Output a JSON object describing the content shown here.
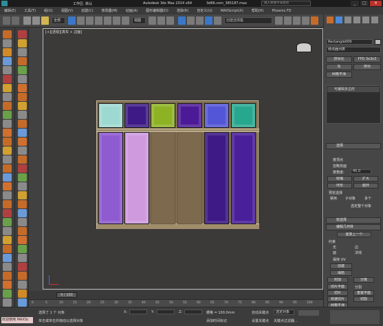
{
  "title": {
    "app": "Autodesk 3ds Max  2014 x64",
    "file": "3d66.com_385187.max",
    "search_placeholder": "键入关键字或短语",
    "workspace_label": "工作区: 默认"
  },
  "menu": [
    "编辑(E)",
    "工具(T)",
    "组(G)",
    "视图(V)",
    "创建(C)",
    "修改器(M)",
    "动画(A)",
    "图形编辑器(D)",
    "渲染(R)",
    "自定义(U)",
    "MAXScript(X)",
    "帮助(H)",
    "Phoenix FD"
  ],
  "toolbar": {
    "filter_value": "全部",
    "view_value": "视图",
    "selection_set_placeholder": "创建选择集"
  },
  "viewport": {
    "label": "[+][透视][真实 + 边面]"
  },
  "command_panel": {
    "object_name": "Rectangle009",
    "modifier_list": "修改器列表",
    "buttons": [
      "挤出化",
      "FFD 3x3x3",
      "车",
      "挤出",
      "网格平滑"
    ],
    "stack_item": "可编辑多边形",
    "selection_title": "选择",
    "selection_options": [
      "按顶点",
      "忽略背面",
      "按角度:",
      "收缩",
      "扩大",
      "环形",
      "循环"
    ],
    "angle_value": "45.0",
    "preview_label": "预览选择",
    "preview_options": [
      "禁用",
      "子对象",
      "多个"
    ],
    "selected_count": "选定整个对象",
    "soft_sel_title": "软选择",
    "edit_geom_title": "编辑几何体",
    "repeat_last": "重复上一个",
    "constraint_label": "约束",
    "constraint_options": [
      "无",
      "边",
      "面",
      "法线"
    ],
    "preserve_uv": "保持 UV",
    "create_btn": "创建",
    "collapse_btn": "塌陷",
    "attach_btn": "附加",
    "detach_btn": "分离",
    "slice_plane_btn": "切片平面",
    "split_btn": "分割",
    "slice_btn": "切片",
    "reset_plane_btn": "重置平面",
    "quickslice_btn": "快速切片",
    "cut_btn": "切割",
    "meshsmooth_btn": "网格平滑"
  },
  "timeline": {
    "frame": "0 / 100",
    "ticks": [
      "0",
      "5",
      "10",
      "15",
      "20",
      "25",
      "30",
      "35",
      "40",
      "45",
      "50",
      "55",
      "60",
      "65",
      "70",
      "75",
      "80",
      "85",
      "90",
      "95",
      "100"
    ]
  },
  "statusbar": {
    "welcome": "欢迎使用 MAXSc",
    "selected": "选择了 1 个 对象",
    "hint": "单击或单击并拖动以选择对象",
    "x_label": "X:",
    "y_label": "Y:",
    "z_label": "Z:",
    "grid": "栅格 = 100.0mm",
    "add_time_tag": "添加时间标记",
    "autokey": "自动关键点",
    "set_key": "设置关键点",
    "selected_object": "选定对象",
    "key_filters": "关键点过滤器..."
  },
  "cabinet": {
    "upper_door_colors": [
      "#9ed9d1",
      "#3d1a86",
      "#8db224",
      "#4c1a96",
      "#5356d6",
      "#28a78f"
    ],
    "lower_door_colors": [
      "#8f5bd0",
      "#cf9ade",
      "#7d6a4e",
      "#7d6a4e",
      "#3d1a86",
      "#4a1f9a"
    ],
    "frame_color": "#7d6a4e"
  }
}
